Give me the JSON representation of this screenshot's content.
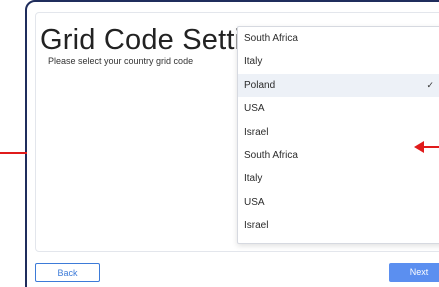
{
  "page": {
    "title": "Grid Code Settings",
    "subtitle": "Please select your country grid code"
  },
  "dropdown": {
    "options": [
      {
        "label": "South Africa",
        "selected": false
      },
      {
        "label": "Italy",
        "selected": false
      },
      {
        "label": "Poland",
        "selected": true
      },
      {
        "label": "USA",
        "selected": false
      },
      {
        "label": "Israel",
        "selected": false
      },
      {
        "label": "South Africa",
        "selected": false
      },
      {
        "label": "Italy",
        "selected": false
      },
      {
        "label": "USA",
        "selected": false
      },
      {
        "label": "Israel",
        "selected": false
      }
    ],
    "check_glyph": "✓"
  },
  "footer": {
    "back_label": "Back",
    "next_label": "Next"
  },
  "colors": {
    "frame": "#1f2d5c",
    "accent": "#3d7bd8",
    "next_bg": "#5b8ff0",
    "annotation": "#e01b1b",
    "selected_bg": "#edf1f7"
  }
}
